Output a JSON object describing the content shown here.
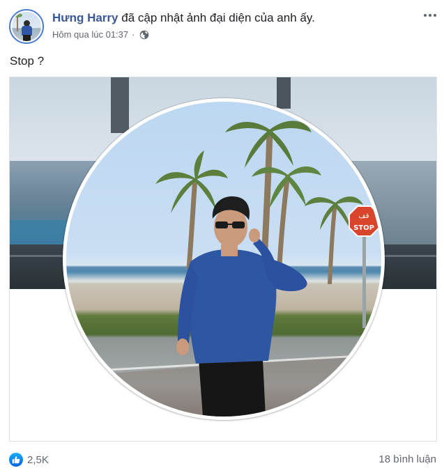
{
  "post": {
    "author_name": "Hưng Harry",
    "action_text": "đã cập nhật ảnh đại diện của anh ấy.",
    "timestamp": "Hôm qua lúc 01:37",
    "separator": "·",
    "audience_icon": "globe-icon",
    "caption": "Stop ?",
    "more_icon": "more-options-icon"
  },
  "photo": {
    "stop_sign_arabic": "قف",
    "stop_sign_text": "STOP"
  },
  "footer": {
    "reaction_icon": "like-icon",
    "reaction_count": "2,5K",
    "comments_label": "18 bình luận"
  },
  "colors": {
    "author_link": "#385898",
    "secondary_text": "#606770",
    "like_blue": "#1877f2",
    "border": "#dddfe2"
  }
}
